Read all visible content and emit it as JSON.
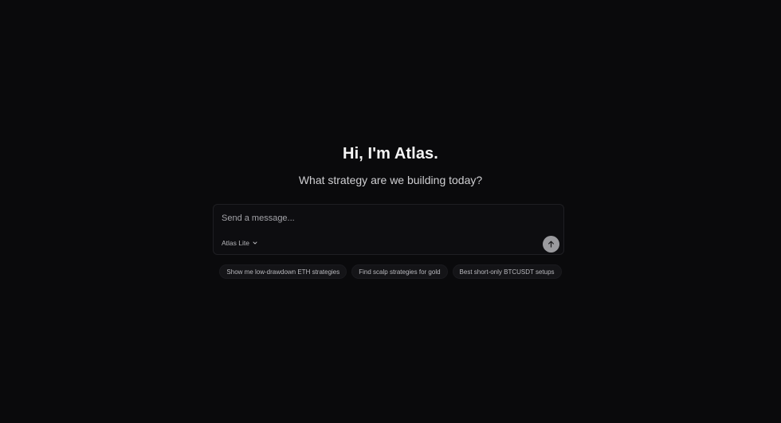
{
  "greeting": {
    "title": "Hi, I'm Atlas.",
    "subtitle": "What strategy are we building today?"
  },
  "composer": {
    "placeholder": "Send a message...",
    "value": "",
    "model_label": "Atlas Lite",
    "model_icon": "chevron-down-icon",
    "send_icon": "arrow-up-icon"
  },
  "suggestions": [
    {
      "label": "Show me low-drawdown ETH strategies"
    },
    {
      "label": "Find scalp strategies for gold"
    },
    {
      "label": "Best short-only BTCUSDT setups"
    }
  ],
  "colors": {
    "background": "#0a0a0c",
    "send_button": "#9a9a9e"
  }
}
